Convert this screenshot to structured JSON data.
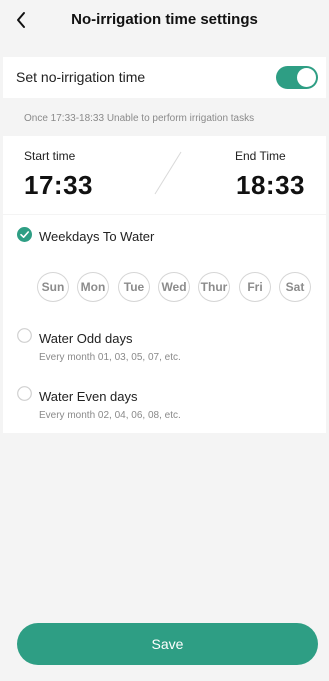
{
  "header": {
    "title": "No-irrigation time settings",
    "back_icon": "chevron-left-icon"
  },
  "toggle": {
    "label": "Set no-irrigation time",
    "enabled": true,
    "color": "#2e9e84"
  },
  "note": "Once 17:33-18:33 Unable to perform irrigation tasks",
  "time": {
    "start_label": "Start time",
    "start_value": "17:33",
    "end_label": "End Time",
    "end_value": "18:33"
  },
  "options": {
    "weekdays": {
      "label": "Weekdays To Water",
      "selected": true
    },
    "days": [
      "Sun",
      "Mon",
      "Tue",
      "Wed",
      "Thur",
      "Fri",
      "Sat"
    ],
    "odd": {
      "label": "Water Odd days",
      "sub": "Every month 01, 03, 05, 07, etc.",
      "selected": false
    },
    "even": {
      "label": "Water Even days",
      "sub": "Every month 02, 04, 06, 08, etc.",
      "selected": false
    }
  },
  "save_label": "Save",
  "accent_color": "#2e9e84"
}
